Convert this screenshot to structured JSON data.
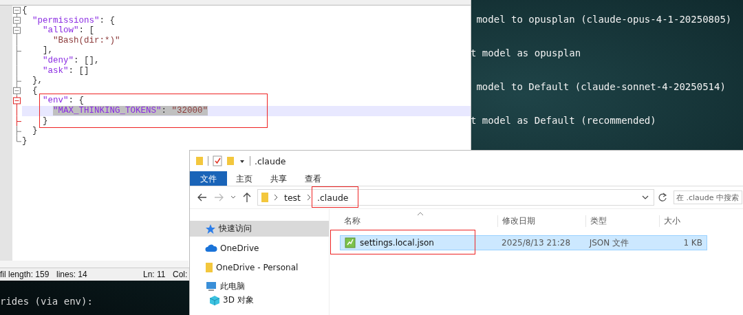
{
  "terminal": {
    "lines": [
      " model to opusplan (claude-opus-4-1-20250805)",
      "t model as opusplan",
      " model to Default (claude-sonnet-4-20250514)",
      "t model as Default (recommended)"
    ],
    "bottom_lines": [
      "rides (via env):"
    ]
  },
  "editor": {
    "lines": [
      {
        "tokens": [
          {
            "text": "{",
            "kind": "punct"
          }
        ],
        "children": [
          {
            "tokens": [
              {
                "text": "\"permissions\"",
                "kind": "key"
              },
              {
                "text": ": {",
                "kind": "punct"
              }
            ],
            "children": [
              {
                "tokens": [
                  {
                    "text": "\"allow\"",
                    "kind": "key"
                  },
                  {
                    "text": ": [",
                    "kind": "punct"
                  }
                ],
                "children": [
                  {
                    "tokens": [
                      {
                        "text": "\"Bash(dir:*)\"",
                        "kind": "string"
                      }
                    ]
                  }
                ]
              },
              {
                "tokens": [
                  {
                    "text": "],",
                    "kind": "punct"
                  }
                ]
              },
              {
                "tokens": [
                  {
                    "text": "\"deny\"",
                    "kind": "key"
                  },
                  {
                    "text": ": [],",
                    "kind": "punct"
                  }
                ]
              },
              {
                "tokens": [
                  {
                    "text": "\"ask\"",
                    "kind": "key"
                  },
                  {
                    "text": ": []",
                    "kind": "punct"
                  }
                ]
              }
            ]
          },
          {
            "tokens": [
              {
                "text": "},",
                "kind": "punct"
              }
            ]
          },
          {
            "tokens": [
              {
                "text": "{",
                "kind": "punct"
              }
            ],
            "children": [
              {
                "tokens": [
                  {
                    "text": "\"env\"",
                    "kind": "key"
                  },
                  {
                    "text": ": {",
                    "kind": "punct"
                  }
                ],
                "active": true,
                "annotated": true,
                "children": [
                  {
                    "tokens": [
                      {
                        "text": "\"MAX_THINKING_TOKENS\"",
                        "kind": "key",
                        "selected": true
                      },
                      {
                        "text": ": ",
                        "kind": "punct",
                        "selected": true
                      },
                      {
                        "text": "\"32000\"",
                        "kind": "string",
                        "selected": true
                      }
                    ],
                    "current": true
                  }
                ]
              },
              {
                "tokens": [
                  {
                    "text": "}",
                    "kind": "punct"
                  }
                ]
              }
            ]
          },
          {
            "tokens": [
              {
                "text": "}",
                "kind": "punct"
              }
            ]
          }
        ]
      },
      {
        "tokens": [
          {
            "text": "}",
            "kind": "punct"
          }
        ]
      }
    ],
    "status": [
      "fil length: 159",
      "lines: 14",
      "Ln: 11",
      "Col:"
    ]
  },
  "explorer": {
    "title": ".claude",
    "ribbon_tabs": [
      {
        "label": "文件",
        "selected": true
      },
      {
        "label": "主页",
        "selected": false
      },
      {
        "label": "共享",
        "selected": false
      },
      {
        "label": "查看",
        "selected": false
      }
    ],
    "breadcrumbs": [
      {
        "label": "test"
      },
      {
        "label": ".claude",
        "annotated": true
      }
    ],
    "search": {
      "placeholder": "在 .claude 中搜索"
    },
    "nav": [
      {
        "label": "快速访问",
        "selected": true
      },
      {
        "label": "OneDrive",
        "selected": false
      },
      {
        "label": "OneDrive - Personal",
        "selected": false
      },
      {
        "label": "此电脑",
        "selected": false
      },
      {
        "label": "3D 对象",
        "selected": false
      }
    ],
    "columns": [
      "名称",
      "修改日期",
      "类型",
      "大小"
    ],
    "files": [
      {
        "name": "settings.local.json",
        "modified": "2025/8/13 21:28",
        "type": "JSON 文件",
        "size": "1 KB",
        "selected": true,
        "annotated": true
      }
    ]
  }
}
